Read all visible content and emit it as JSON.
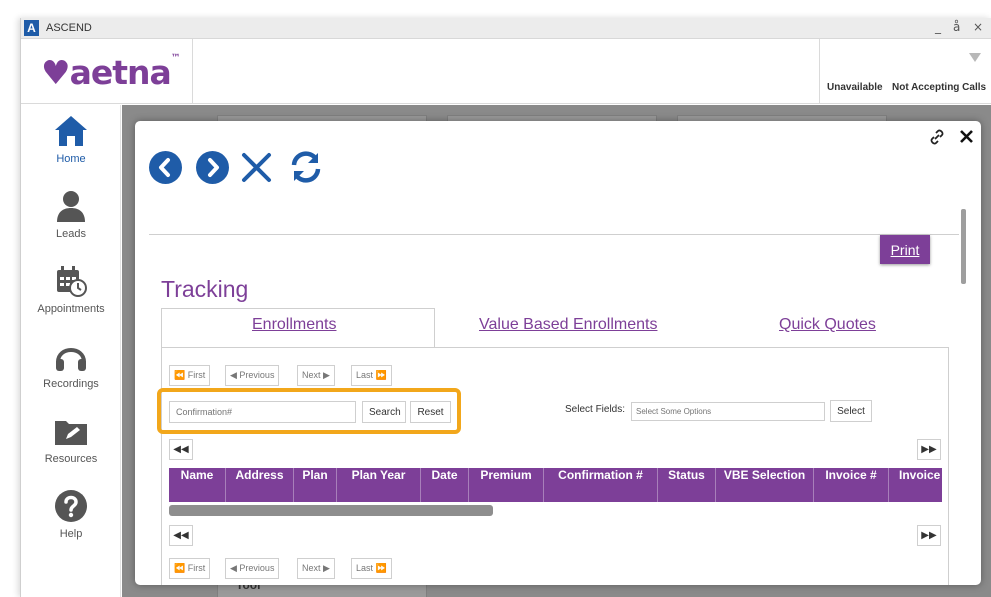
{
  "window": {
    "title": "ASCEND",
    "logo_letter": "A",
    "controls": [
      "_",
      "å",
      "×"
    ]
  },
  "header": {
    "brand": "♥aetna",
    "brand_tm": "™",
    "status_unavailable": "Unavailable",
    "status_calls": "Not Accepting Calls"
  },
  "sidebar": {
    "items": [
      {
        "label": "Home",
        "icon": "home-icon",
        "active": true
      },
      {
        "label": "Leads",
        "icon": "person-icon"
      },
      {
        "label": "Appointments",
        "icon": "calendar-clock-icon"
      },
      {
        "label": "Recordings",
        "icon": "headphones-icon"
      },
      {
        "label": "Resources",
        "icon": "folder-edit-icon"
      },
      {
        "label": "Help",
        "icon": "help-icon"
      }
    ]
  },
  "background": {
    "tool_text": "Tool"
  },
  "modal": {
    "print_label": "Print",
    "title": "Tracking",
    "tabs": [
      {
        "label": "Enrollments",
        "active": true
      },
      {
        "label": "Value Based Enrollments"
      },
      {
        "label": "Quick Quotes"
      }
    ],
    "pager": {
      "first": "First",
      "previous": "Previous",
      "next": "Next",
      "last": "Last"
    },
    "search": {
      "placeholder": "Confirmation#",
      "search_label": "Search",
      "reset_label": "Reset"
    },
    "select_fields": {
      "label": "Select Fields:",
      "placeholder": "Select Some Options",
      "button": "Select"
    },
    "table_columns": [
      "Name",
      "Address",
      "Plan",
      "Plan Year",
      "Date",
      "Premium",
      "Confirmation #",
      "Status",
      "VBE Selection",
      "Invoice #",
      "Invoice"
    ]
  },
  "colors": {
    "brand_purple": "#7d3f98",
    "nav_blue": "#1f5ca8",
    "highlight_orange": "#f2a71b"
  }
}
